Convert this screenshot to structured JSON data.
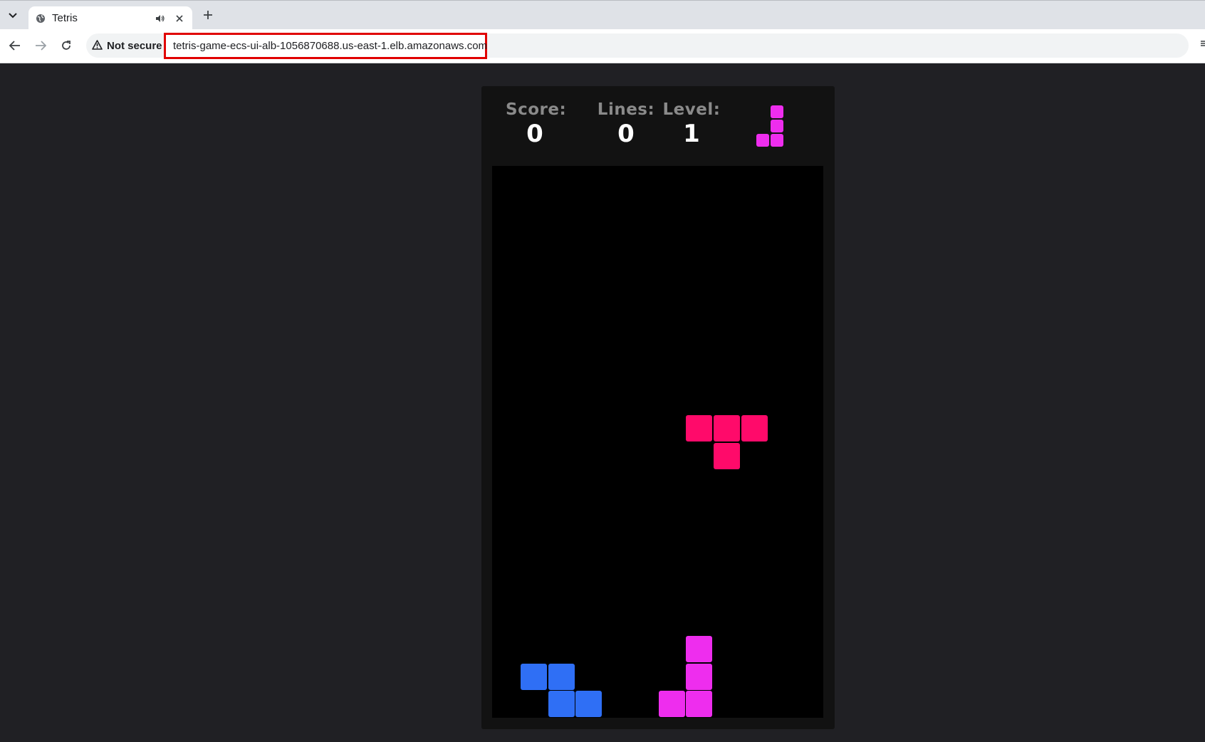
{
  "browser": {
    "tab": {
      "title": "Tetris",
      "favicon": "globe-icon",
      "audio_icon": "speaker-icon",
      "close_icon": "close-icon"
    },
    "new_tab_icon": "plus-icon",
    "security": {
      "icon": "warning-triangle-icon",
      "label": "Not secure"
    },
    "url": "tetris-game-ecs-ui-alb-1056870688.us-east-1.elb.amazonaws.com",
    "url_highlight_color": "#e00000"
  },
  "game": {
    "score": {
      "label": "Score:",
      "value": "0"
    },
    "lines": {
      "label": "Lines:",
      "value": "0"
    },
    "level": {
      "label": "Level:",
      "value": "1"
    },
    "next_piece": {
      "type": "J",
      "color": "#ee2dee",
      "cells": [
        [
          1,
          0
        ],
        [
          1,
          1
        ],
        [
          0,
          2
        ],
        [
          1,
          2
        ]
      ]
    },
    "board": {
      "columns": 12,
      "rows": 20,
      "background": "#000000",
      "active_piece": {
        "type": "T",
        "color": "#ff0a6a",
        "cells": [
          [
            7,
            9
          ],
          [
            8,
            9
          ],
          [
            9,
            9
          ],
          [
            8,
            10
          ]
        ]
      },
      "locked_blocks": [
        {
          "color": "#2f6ff5",
          "cells": [
            [
              1,
              18
            ],
            [
              2,
              18
            ],
            [
              2,
              19
            ],
            [
              3,
              19
            ]
          ]
        },
        {
          "color": "#ee2dee",
          "cells": [
            [
              7,
              17
            ],
            [
              7,
              18
            ],
            [
              6,
              19
            ],
            [
              7,
              19
            ]
          ]
        }
      ]
    }
  }
}
